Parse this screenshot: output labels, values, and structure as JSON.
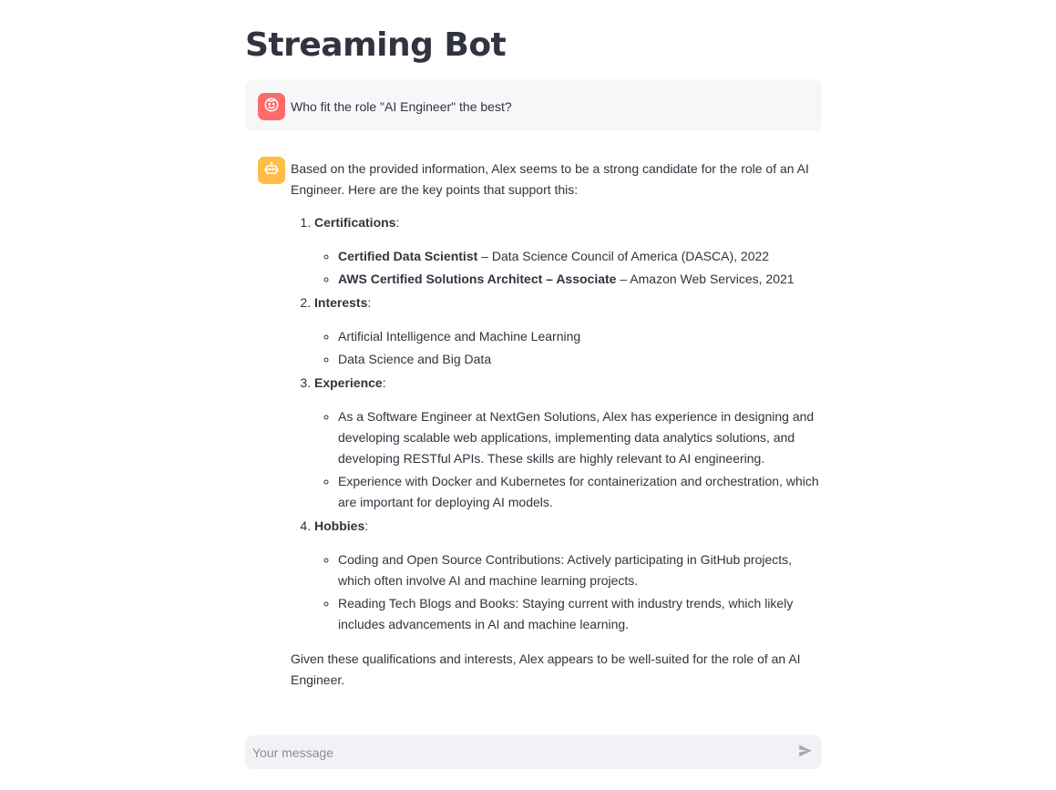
{
  "app": {
    "title": "Streaming Bot"
  },
  "colors": {
    "user_avatar": "#ff6b6b",
    "bot_avatar": "#ffbd45",
    "user_bubble": "#f6f7f9",
    "input_bg": "#f0f2f6",
    "text": "#31333f"
  },
  "user_message": {
    "avatar_icon": "smiley-face-icon",
    "text": "Who fit the role \"AI Engineer\" the best?"
  },
  "bot_message": {
    "avatar_icon": "robot-icon",
    "intro": "Based on the provided information, Alex seems to be a strong candidate for the role of an AI Engineer. Here are the key points that support this:",
    "sections": [
      {
        "heading": "Certifications",
        "items": [
          {
            "bold": "Certified Data Scientist",
            "text": " – Data Science Council of America (DASCA), 2022"
          },
          {
            "bold": "AWS Certified Solutions Architect – Associate",
            "text": " – Amazon Web Services, 2021"
          }
        ]
      },
      {
        "heading": "Interests",
        "items": [
          {
            "bold": "",
            "text": "Artificial Intelligence and Machine Learning"
          },
          {
            "bold": "",
            "text": "Data Science and Big Data"
          }
        ]
      },
      {
        "heading": "Experience",
        "items": [
          {
            "bold": "",
            "text": "As a Software Engineer at NextGen Solutions, Alex has experience in designing and developing scalable web applications, implementing data analytics solutions, and developing RESTful APIs. These skills are highly relevant to AI engineering."
          },
          {
            "bold": "",
            "text": "Experience with Docker and Kubernetes for containerization and orchestration, which are important for deploying AI models."
          }
        ]
      },
      {
        "heading": "Hobbies",
        "items": [
          {
            "bold": "",
            "text": "Coding and Open Source Contributions: Actively participating in GitHub projects, which often involve AI and machine learning projects."
          },
          {
            "bold": "",
            "text": "Reading Tech Blogs and Books: Staying current with industry trends, which likely includes advancements in AI and machine learning."
          }
        ]
      }
    ],
    "closing": "Given these qualifications and interests, Alex appears to be well-suited for the role of an AI Engineer."
  },
  "chat_input": {
    "placeholder": "Your message",
    "value": "",
    "send_icon": "send-icon"
  }
}
